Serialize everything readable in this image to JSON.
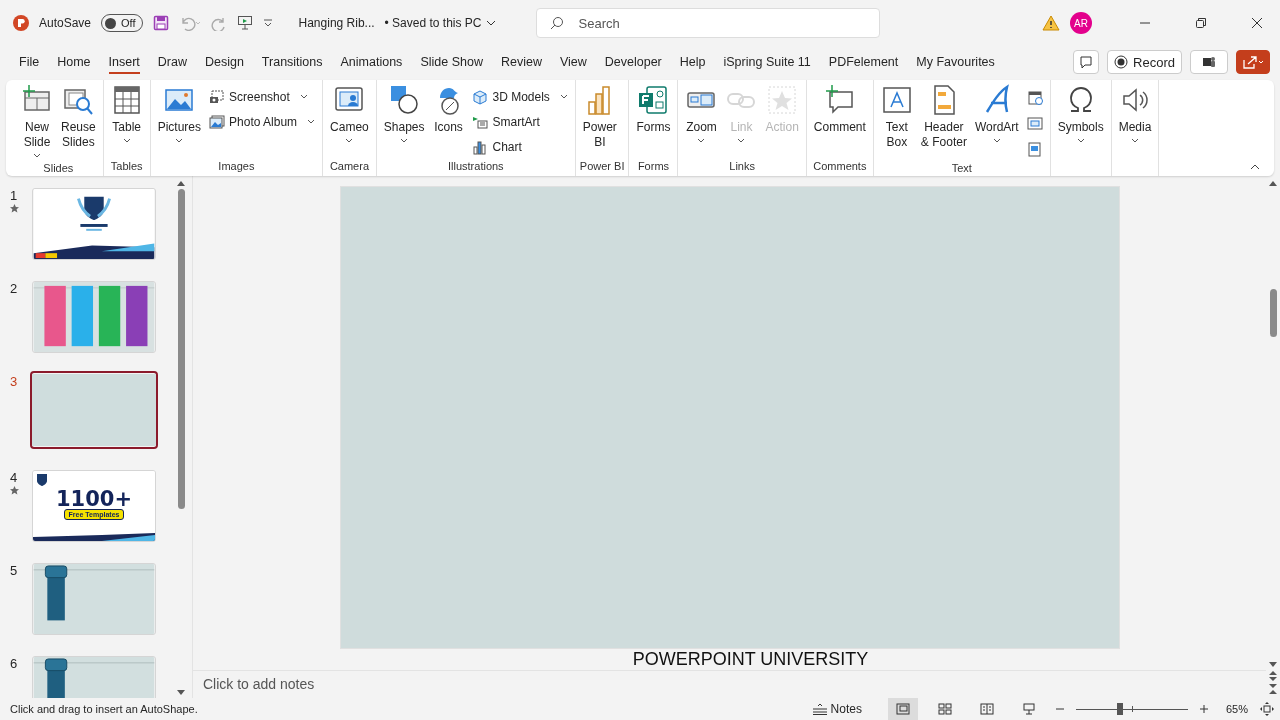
{
  "title_bar": {
    "autosave_label": "AutoSave",
    "autosave": {
      "on": false,
      "label": "Off"
    },
    "document_title": "Hanging Rib...",
    "save_status": "• Saved to this PC",
    "search": {
      "placeholder": "Search"
    },
    "avatar": "AR"
  },
  "tabs": [
    {
      "label": "File",
      "selected": false
    },
    {
      "label": "Home",
      "selected": false
    },
    {
      "label": "Insert",
      "selected": true
    },
    {
      "label": "Draw",
      "selected": false
    },
    {
      "label": "Design",
      "selected": false
    },
    {
      "label": "Transitions",
      "selected": false
    },
    {
      "label": "Animations",
      "selected": false
    },
    {
      "label": "Slide Show",
      "selected": false
    },
    {
      "label": "Review",
      "selected": false
    },
    {
      "label": "View",
      "selected": false
    },
    {
      "label": "Developer",
      "selected": false
    },
    {
      "label": "Help",
      "selected": false
    },
    {
      "label": "iSpring Suite 11",
      "selected": false
    },
    {
      "label": "PDFelement",
      "selected": false
    },
    {
      "label": "My Favourites",
      "selected": false
    }
  ],
  "ribbon_actions": {
    "record": "Record"
  },
  "ribbon": {
    "groups": [
      {
        "label": "Slides",
        "items": [
          {
            "kind": "large",
            "lines": [
              "New",
              "Slide"
            ],
            "dropdown": true,
            "disabled": false
          },
          {
            "kind": "large",
            "lines": [
              "Reuse",
              "Slides"
            ],
            "dropdown": false,
            "disabled": false
          }
        ]
      },
      {
        "label": "Tables",
        "items": [
          {
            "kind": "large",
            "lines": [
              "Table"
            ],
            "dropdown": true,
            "disabled": false
          }
        ]
      },
      {
        "label": "Images",
        "items": [
          {
            "kind": "large",
            "lines": [
              "Pictures"
            ],
            "dropdown": true,
            "disabled": false
          },
          {
            "kind": "small",
            "lines": [
              "Screenshot"
            ],
            "dropdown": true,
            "disabled": false
          },
          {
            "kind": "small",
            "lines": [
              "Photo Album"
            ],
            "dropdown": true,
            "disabled": false
          }
        ]
      },
      {
        "label": "Camera",
        "items": [
          {
            "kind": "large",
            "lines": [
              "Cameo"
            ],
            "dropdown": true,
            "disabled": false
          }
        ]
      },
      {
        "label": "Illustrations",
        "items": [
          {
            "kind": "large",
            "lines": [
              "Shapes"
            ],
            "dropdown": true,
            "disabled": false
          },
          {
            "kind": "large",
            "lines": [
              "Icons"
            ],
            "dropdown": false,
            "disabled": false
          },
          {
            "kind": "small",
            "lines": [
              "3D Models"
            ],
            "dropdown": true,
            "disabled": false
          },
          {
            "kind": "small",
            "lines": [
              "SmartArt"
            ],
            "dropdown": false,
            "disabled": false
          },
          {
            "kind": "small",
            "lines": [
              "Chart"
            ],
            "dropdown": false,
            "disabled": false
          }
        ]
      },
      {
        "label": "Power BI",
        "items": [
          {
            "kind": "large",
            "lines": [
              "Power",
              "BI"
            ],
            "dropdown": false,
            "disabled": false
          }
        ]
      },
      {
        "label": "Forms",
        "items": [
          {
            "kind": "large",
            "lines": [
              "Forms"
            ],
            "dropdown": false,
            "disabled": false
          }
        ]
      },
      {
        "label": "Links",
        "items": [
          {
            "kind": "large",
            "lines": [
              "Zoom"
            ],
            "dropdown": true,
            "disabled": false
          },
          {
            "kind": "large",
            "lines": [
              "Link"
            ],
            "dropdown": true,
            "disabled": true
          },
          {
            "kind": "large",
            "lines": [
              "Action"
            ],
            "dropdown": false,
            "disabled": true
          }
        ]
      },
      {
        "label": "Comments",
        "items": [
          {
            "kind": "large",
            "lines": [
              "Comment"
            ],
            "dropdown": false,
            "disabled": false
          }
        ]
      },
      {
        "label": "Text",
        "items": [
          {
            "kind": "large",
            "lines": [
              "Text",
              "Box"
            ],
            "dropdown": false,
            "disabled": false
          },
          {
            "kind": "large",
            "lines": [
              "Header",
              "& Footer"
            ],
            "dropdown": false,
            "disabled": false
          },
          {
            "kind": "large",
            "lines": [
              "WordArt"
            ],
            "dropdown": true,
            "disabled": false
          },
          {
            "kind": "icon_only",
            "dropdown": false,
            "disabled": false
          },
          {
            "kind": "icon_only",
            "dropdown": false,
            "disabled": false
          },
          {
            "kind": "icon_only",
            "dropdown": false,
            "disabled": false
          }
        ]
      },
      {
        "items": [
          {
            "kind": "large",
            "lines": [
              "Symbols"
            ],
            "dropdown": true,
            "disabled": false
          }
        ]
      },
      {
        "items": [
          {
            "kind": "large",
            "lines": [
              "Media"
            ],
            "dropdown": true,
            "disabled": false
          }
        ]
      }
    ]
  },
  "slides_panel": {
    "slides": [
      {
        "number": "1",
        "kind": "title",
        "starred": true,
        "selected": false
      },
      {
        "number": "2",
        "kind": "ribbons",
        "starred": false,
        "selected": false
      },
      {
        "number": "3",
        "kind": "blank",
        "starred": false,
        "selected": true
      },
      {
        "number": "4",
        "kind": "promo",
        "starred": true,
        "selected": false,
        "headline": "1100+",
        "badge": "Free Templates"
      },
      {
        "number": "5",
        "kind": "single_ribbon",
        "starred": false,
        "selected": false
      },
      {
        "number": "6",
        "kind": "single_ribbon",
        "starred": false,
        "selected": false
      }
    ]
  },
  "slide": {
    "footer": "POWERPOINT UNIVERSITY"
  },
  "notes": {
    "placeholder": "Click to add notes"
  },
  "status_bar": {
    "message": "Click and drag to insert an AutoShape.",
    "notes_button": "Notes",
    "views": [
      {
        "selected": true
      },
      {
        "selected": false
      },
      {
        "selected": false
      },
      {
        "selected": false
      }
    ],
    "zoom": {
      "level": 0.39,
      "reading": "65%"
    }
  }
}
